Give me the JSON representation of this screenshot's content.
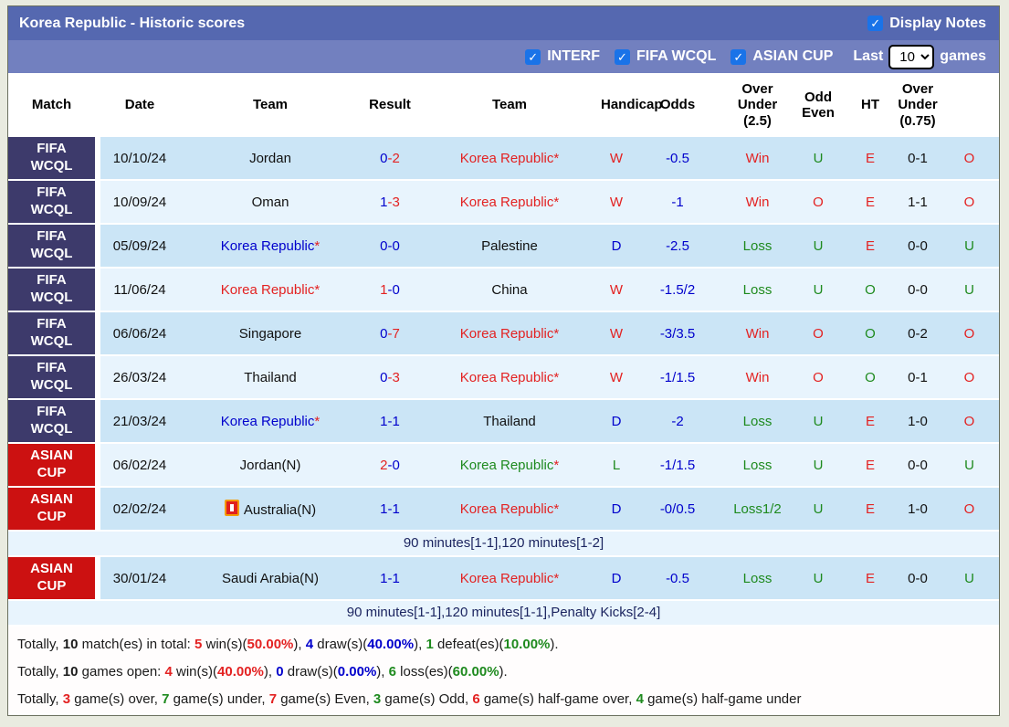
{
  "colors": {
    "red": "#e32222",
    "blue": "#0000cc",
    "green": "#1e8a1e",
    "black": "#111111",
    "navy": "#1c2560"
  },
  "header": {
    "title": "Korea Republic - Historic scores",
    "display_notes_label": "Display Notes",
    "display_notes_checked": true
  },
  "filters": {
    "items": [
      {
        "label": "INTERF",
        "checked": true
      },
      {
        "label": "FIFA WCQL",
        "checked": true
      },
      {
        "label": "ASIAN CUP",
        "checked": true
      }
    ],
    "last_label": "Last",
    "games_label": "games",
    "last_value": "10"
  },
  "table": {
    "columns": [
      "Match",
      "Date",
      "Team",
      "Result",
      "Team",
      "Handicap",
      "Odds",
      "Over\nUnder\n(2.5)",
      "Odd\nEven",
      "HT",
      "Over\nUnder\n(0.75)"
    ],
    "rows": [
      {
        "comp_lines": [
          "FIFA",
          "WCQL"
        ],
        "comp_type": "fifa",
        "date": "10/10/24",
        "team1": [
          {
            "t": "Jordan",
            "c": "black"
          }
        ],
        "result": [
          {
            "t": "0",
            "c": "blue"
          },
          {
            "t": "-2",
            "c": "red"
          }
        ],
        "team2": [
          {
            "t": "Korea Republic",
            "c": "red"
          },
          {
            "t": "*",
            "c": "red"
          }
        ],
        "wdl": {
          "t": "W",
          "c": "red"
        },
        "handicap": {
          "t": "-0.5",
          "c": "blue"
        },
        "odds": {
          "t": "Win",
          "c": "red"
        },
        "ou25": {
          "t": "U",
          "c": "green"
        },
        "odd_even": {
          "t": "E",
          "c": "red"
        },
        "ht": {
          "t": "0-1",
          "c": "black"
        },
        "ou075": {
          "t": "O",
          "c": "red"
        }
      },
      {
        "comp_lines": [
          "FIFA",
          "WCQL"
        ],
        "comp_type": "fifa",
        "date": "10/09/24",
        "team1": [
          {
            "t": "Oman",
            "c": "black"
          }
        ],
        "result": [
          {
            "t": "1",
            "c": "blue"
          },
          {
            "t": "-3",
            "c": "red"
          }
        ],
        "team2": [
          {
            "t": "Korea Republic",
            "c": "red"
          },
          {
            "t": "*",
            "c": "red"
          }
        ],
        "wdl": {
          "t": "W",
          "c": "red"
        },
        "handicap": {
          "t": "-1",
          "c": "blue"
        },
        "odds": {
          "t": "Win",
          "c": "red"
        },
        "ou25": {
          "t": "O",
          "c": "red"
        },
        "odd_even": {
          "t": "E",
          "c": "red"
        },
        "ht": {
          "t": "1-1",
          "c": "black"
        },
        "ou075": {
          "t": "O",
          "c": "red"
        }
      },
      {
        "comp_lines": [
          "FIFA",
          "WCQL"
        ],
        "comp_type": "fifa",
        "date": "05/09/24",
        "team1": [
          {
            "t": "Korea Republic",
            "c": "blue"
          },
          {
            "t": "*",
            "c": "red"
          }
        ],
        "result": [
          {
            "t": "0",
            "c": "blue"
          },
          {
            "t": "-0",
            "c": "blue"
          }
        ],
        "team2": [
          {
            "t": "Palestine",
            "c": "black"
          }
        ],
        "wdl": {
          "t": "D",
          "c": "blue"
        },
        "handicap": {
          "t": "-2.5",
          "c": "blue"
        },
        "odds": {
          "t": "Loss",
          "c": "green"
        },
        "ou25": {
          "t": "U",
          "c": "green"
        },
        "odd_even": {
          "t": "E",
          "c": "red"
        },
        "ht": {
          "t": "0-0",
          "c": "black"
        },
        "ou075": {
          "t": "U",
          "c": "green"
        }
      },
      {
        "comp_lines": [
          "FIFA",
          "WCQL"
        ],
        "comp_type": "fifa",
        "date": "11/06/24",
        "team1": [
          {
            "t": "Korea Republic",
            "c": "red"
          },
          {
            "t": "*",
            "c": "red"
          }
        ],
        "result": [
          {
            "t": "1",
            "c": "red"
          },
          {
            "t": "-0",
            "c": "blue"
          }
        ],
        "team2": [
          {
            "t": "China",
            "c": "black"
          }
        ],
        "wdl": {
          "t": "W",
          "c": "red"
        },
        "handicap": {
          "t": "-1.5/2",
          "c": "blue"
        },
        "odds": {
          "t": "Loss",
          "c": "green"
        },
        "ou25": {
          "t": "U",
          "c": "green"
        },
        "odd_even": {
          "t": "O",
          "c": "green"
        },
        "ht": {
          "t": "0-0",
          "c": "black"
        },
        "ou075": {
          "t": "U",
          "c": "green"
        }
      },
      {
        "comp_lines": [
          "FIFA",
          "WCQL"
        ],
        "comp_type": "fifa",
        "date": "06/06/24",
        "team1": [
          {
            "t": "Singapore",
            "c": "black"
          }
        ],
        "result": [
          {
            "t": "0",
            "c": "blue"
          },
          {
            "t": "-7",
            "c": "red"
          }
        ],
        "team2": [
          {
            "t": "Korea Republic",
            "c": "red"
          },
          {
            "t": "*",
            "c": "red"
          }
        ],
        "wdl": {
          "t": "W",
          "c": "red"
        },
        "handicap": {
          "t": "-3/3.5",
          "c": "blue"
        },
        "odds": {
          "t": "Win",
          "c": "red"
        },
        "ou25": {
          "t": "O",
          "c": "red"
        },
        "odd_even": {
          "t": "O",
          "c": "green"
        },
        "ht": {
          "t": "0-2",
          "c": "black"
        },
        "ou075": {
          "t": "O",
          "c": "red"
        }
      },
      {
        "comp_lines": [
          "FIFA",
          "WCQL"
        ],
        "comp_type": "fifa",
        "date": "26/03/24",
        "team1": [
          {
            "t": "Thailand",
            "c": "black"
          }
        ],
        "result": [
          {
            "t": "0",
            "c": "blue"
          },
          {
            "t": "-3",
            "c": "red"
          }
        ],
        "team2": [
          {
            "t": "Korea Republic",
            "c": "red"
          },
          {
            "t": "*",
            "c": "red"
          }
        ],
        "wdl": {
          "t": "W",
          "c": "red"
        },
        "handicap": {
          "t": "-1/1.5",
          "c": "blue"
        },
        "odds": {
          "t": "Win",
          "c": "red"
        },
        "ou25": {
          "t": "O",
          "c": "red"
        },
        "odd_even": {
          "t": "O",
          "c": "green"
        },
        "ht": {
          "t": "0-1",
          "c": "black"
        },
        "ou075": {
          "t": "O",
          "c": "red"
        }
      },
      {
        "comp_lines": [
          "FIFA",
          "WCQL"
        ],
        "comp_type": "fifa",
        "date": "21/03/24",
        "team1": [
          {
            "t": "Korea Republic",
            "c": "blue"
          },
          {
            "t": "*",
            "c": "red"
          }
        ],
        "result": [
          {
            "t": "1",
            "c": "blue"
          },
          {
            "t": "-1",
            "c": "blue"
          }
        ],
        "team2": [
          {
            "t": "Thailand",
            "c": "black"
          }
        ],
        "wdl": {
          "t": "D",
          "c": "blue"
        },
        "handicap": {
          "t": "-2",
          "c": "blue"
        },
        "odds": {
          "t": "Loss",
          "c": "green"
        },
        "ou25": {
          "t": "U",
          "c": "green"
        },
        "odd_even": {
          "t": "E",
          "c": "red"
        },
        "ht": {
          "t": "1-0",
          "c": "black"
        },
        "ou075": {
          "t": "O",
          "c": "red"
        }
      },
      {
        "comp_lines": [
          "ASIAN",
          "CUP"
        ],
        "comp_type": "asian",
        "date": "06/02/24",
        "team1": [
          {
            "t": "Jordan(N)",
            "c": "black"
          }
        ],
        "result": [
          {
            "t": "2",
            "c": "red"
          },
          {
            "t": "-0",
            "c": "blue"
          }
        ],
        "team2": [
          {
            "t": "Korea Republic",
            "c": "green"
          },
          {
            "t": "*",
            "c": "red"
          }
        ],
        "wdl": {
          "t": "L",
          "c": "green"
        },
        "handicap": {
          "t": "-1/1.5",
          "c": "blue"
        },
        "odds": {
          "t": "Loss",
          "c": "green"
        },
        "ou25": {
          "t": "U",
          "c": "green"
        },
        "odd_even": {
          "t": "E",
          "c": "red"
        },
        "ht": {
          "t": "0-0",
          "c": "black"
        },
        "ou075": {
          "t": "U",
          "c": "green"
        }
      },
      {
        "comp_lines": [
          "ASIAN",
          "CUP"
        ],
        "comp_type": "asian",
        "date": "02/02/24",
        "flag1": true,
        "team1": [
          {
            "t": "Australia(N)",
            "c": "black"
          }
        ],
        "result": [
          {
            "t": "1",
            "c": "blue"
          },
          {
            "t": "-1",
            "c": "blue"
          }
        ],
        "team2": [
          {
            "t": "Korea Republic",
            "c": "red"
          },
          {
            "t": "*",
            "c": "red"
          }
        ],
        "wdl": {
          "t": "D",
          "c": "blue"
        },
        "handicap": {
          "t": "-0/0.5",
          "c": "blue"
        },
        "odds": {
          "t": "Loss1/2",
          "c": "green"
        },
        "ou25": {
          "t": "U",
          "c": "green"
        },
        "odd_even": {
          "t": "E",
          "c": "red"
        },
        "ht": {
          "t": "1-0",
          "c": "black"
        },
        "ou075": {
          "t": "O",
          "c": "red"
        },
        "note": "90 minutes[1-1],120 minutes[1-2]"
      },
      {
        "comp_lines": [
          "ASIAN",
          "CUP"
        ],
        "comp_type": "asian",
        "date": "30/01/24",
        "team1": [
          {
            "t": "Saudi Arabia(N)",
            "c": "black"
          }
        ],
        "result": [
          {
            "t": "1",
            "c": "blue"
          },
          {
            "t": "-1",
            "c": "blue"
          }
        ],
        "team2": [
          {
            "t": "Korea Republic",
            "c": "red"
          },
          {
            "t": "*",
            "c": "red"
          }
        ],
        "wdl": {
          "t": "D",
          "c": "blue"
        },
        "handicap": {
          "t": "-0.5",
          "c": "blue"
        },
        "odds": {
          "t": "Loss",
          "c": "green"
        },
        "ou25": {
          "t": "U",
          "c": "green"
        },
        "odd_even": {
          "t": "E",
          "c": "red"
        },
        "ht": {
          "t": "0-0",
          "c": "black"
        },
        "ou075": {
          "t": "U",
          "c": "green"
        },
        "note": "90 minutes[1-1],120 minutes[1-1],Penalty Kicks[2-4]"
      }
    ]
  },
  "totals": [
    [
      {
        "t": "Totally, "
      },
      {
        "t": "10",
        "b": 1
      },
      {
        "t": " match(es) in total: "
      },
      {
        "t": "5",
        "c": "red",
        "b": 1
      },
      {
        "t": " win(s)("
      },
      {
        "t": "50.00%",
        "c": "red",
        "b": 1
      },
      {
        "t": "), "
      },
      {
        "t": "4",
        "c": "blue",
        "b": 1
      },
      {
        "t": " draw(s)("
      },
      {
        "t": "40.00%",
        "c": "blue",
        "b": 1
      },
      {
        "t": "), "
      },
      {
        "t": "1",
        "c": "green",
        "b": 1
      },
      {
        "t": " defeat(es)("
      },
      {
        "t": "10.00%",
        "c": "green",
        "b": 1
      },
      {
        "t": ")."
      }
    ],
    [
      {
        "t": "Totally, "
      },
      {
        "t": "10",
        "b": 1
      },
      {
        "t": " games open: "
      },
      {
        "t": "4",
        "c": "red",
        "b": 1
      },
      {
        "t": " win(s)("
      },
      {
        "t": "40.00%",
        "c": "red",
        "b": 1
      },
      {
        "t": "), "
      },
      {
        "t": "0",
        "c": "blue",
        "b": 1
      },
      {
        "t": " draw(s)("
      },
      {
        "t": "0.00%",
        "c": "blue",
        "b": 1
      },
      {
        "t": "), "
      },
      {
        "t": "6",
        "c": "green",
        "b": 1
      },
      {
        "t": " loss(es)("
      },
      {
        "t": "60.00%",
        "c": "green",
        "b": 1
      },
      {
        "t": ")."
      }
    ],
    [
      {
        "t": "Totally, "
      },
      {
        "t": "3",
        "c": "red",
        "b": 1
      },
      {
        "t": " game(s) over, "
      },
      {
        "t": "7",
        "c": "green",
        "b": 1
      },
      {
        "t": " game(s) under, "
      },
      {
        "t": "7",
        "c": "red",
        "b": 1
      },
      {
        "t": " game(s) Even, "
      },
      {
        "t": "3",
        "c": "green",
        "b": 1
      },
      {
        "t": " game(s) Odd, "
      },
      {
        "t": "6",
        "c": "red",
        "b": 1
      },
      {
        "t": " game(s) half-game over, "
      },
      {
        "t": "4",
        "c": "green",
        "b": 1
      },
      {
        "t": " game(s) half-game under"
      }
    ]
  ]
}
